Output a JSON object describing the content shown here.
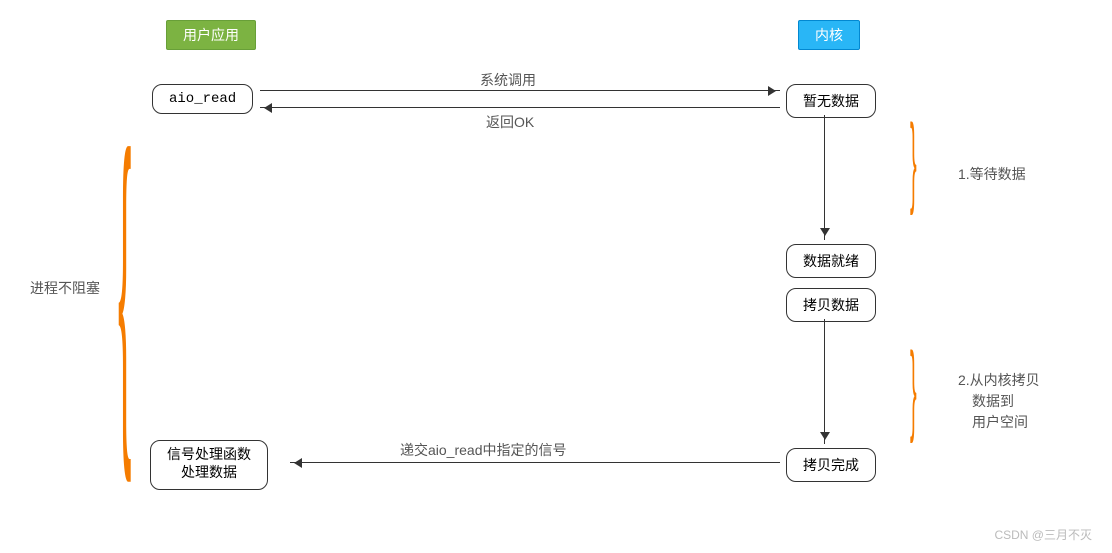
{
  "headers": {
    "user": "用户应用",
    "kernel": "内核"
  },
  "nodes": {
    "aio_read": "aio_read",
    "no_data": "暂无数据",
    "data_ready": "数据就绪",
    "copy_data": "拷贝数据",
    "copy_done": "拷贝完成",
    "handler": "信号处理函数\n处理数据",
    "handler_l1": "信号处理函数",
    "handler_l2": "处理数据"
  },
  "labels": {
    "syscall": "系统调用",
    "return_ok": "返回OK",
    "signal": "递交aio_read中指定的信号"
  },
  "left_note": "进程不阻塞",
  "right_note_1": "1.等待数据",
  "right_note_2_l1": "2.从内核拷贝",
  "right_note_2_l2": "数据到",
  "right_note_2_l3": "用户空间",
  "watermark": "CSDN @三月不灭"
}
